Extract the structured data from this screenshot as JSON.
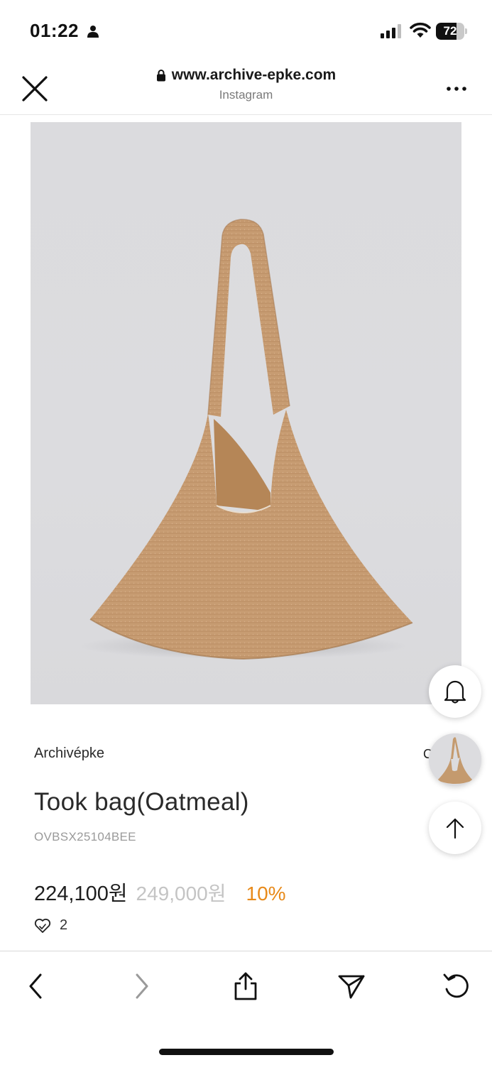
{
  "status_bar": {
    "time": "01:22",
    "battery": "72",
    "battery_level": 0.72
  },
  "browser": {
    "url": "www.archive-epke.com",
    "source": "Instagram"
  },
  "product": {
    "brand": "Archivépke",
    "name": "Took bag(Oatmeal)",
    "code": "OVBSX25104BEE",
    "price": "224,100원",
    "original_price": "249,000원",
    "discount": "10%",
    "likes": "2",
    "peek_char": "C"
  },
  "colors": {
    "accent": "#e88a1a",
    "muted": "#c4c4c4"
  },
  "icons": {
    "close": "close-icon",
    "more": "more-dots-icon",
    "bell": "bell-icon",
    "up": "arrow-up-icon",
    "back": "chevron-left-icon",
    "forward": "chevron-right-icon",
    "share": "share-icon",
    "send": "paper-plane-icon",
    "reload": "reload-icon"
  }
}
